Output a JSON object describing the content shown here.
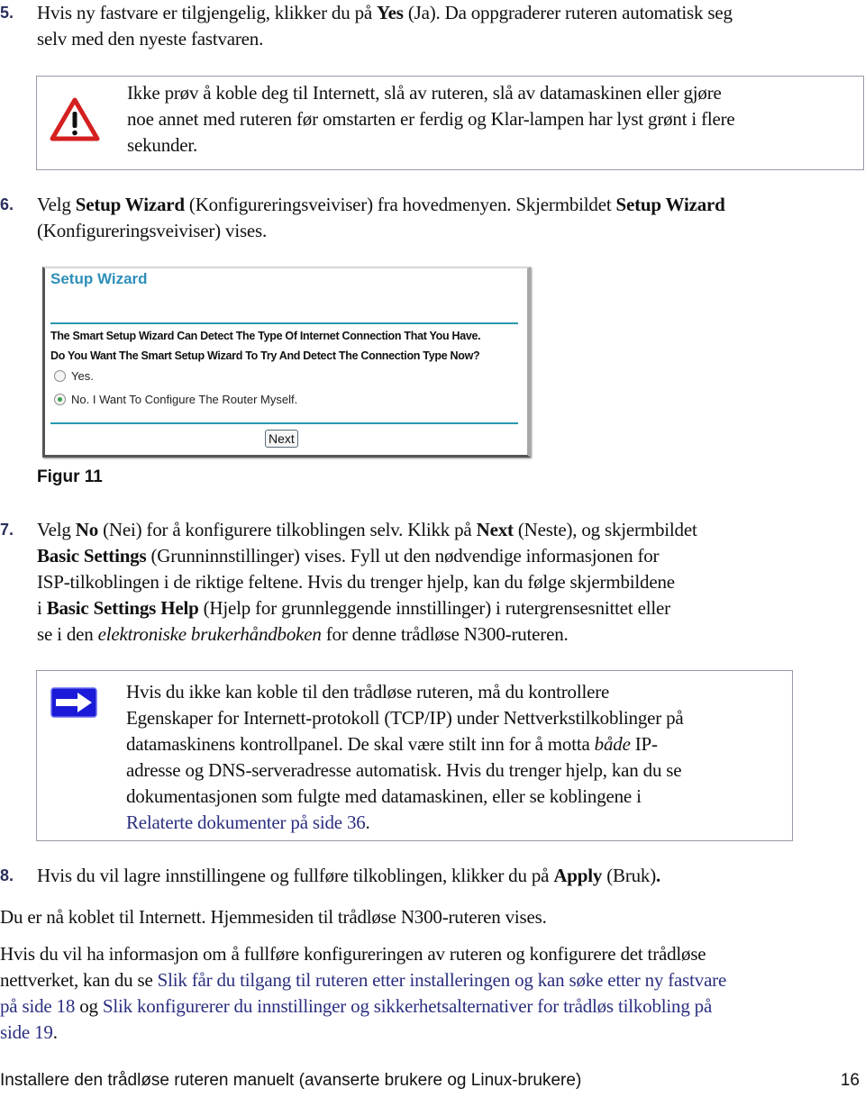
{
  "step5": {
    "number": "5.",
    "line1_pre": "Hvis ny fastvare er tilgjengelig, klikker du på ",
    "line1_bold": "Yes",
    "line1_post": " (Ja). Da oppgraderer ruteren automatisk seg",
    "line2": "selv med den nyeste fastvaren."
  },
  "warning": {
    "icon": "warning-triangle-icon",
    "lines": [
      "Ikke prøv å koble deg til Internett, slå av ruteren, slå av datamaskinen eller gjøre",
      "noe annet med ruteren før omstarten er ferdig og Klar-lampen har lyst grønt i flere",
      "sekunder."
    ]
  },
  "step6": {
    "number": "6.",
    "t1": "Velg ",
    "b1": "Setup Wizard",
    "t2": " (Konfigureringsveiviser) fra hovedmenyen. Skjermbildet ",
    "b2": "Setup Wizard",
    "t3": "(Konfigureringsveiviser) vises."
  },
  "wizard": {
    "title": "Setup Wizard",
    "question1": "The Smart Setup Wizard Can Detect The Type Of Internet Connection That You Have.",
    "question2": "Do You Want The Smart Setup Wizard To Try And Detect The Connection Type Now?",
    "options": [
      {
        "label": "Yes.",
        "selected": false
      },
      {
        "label": "No. I Want To Configure The Router Myself.",
        "selected": true
      }
    ],
    "next_button": "Next",
    "accent_color": "#2e8fb8"
  },
  "figure_caption": "Figur 11",
  "step7": {
    "number": "7.",
    "l1_a": "Velg ",
    "l1_b": "No",
    "l1_c": " (Nei) for å konfigurere tilkoblingen selv. Klikk på ",
    "l1_d": "Next",
    "l1_e": " (Neste), og skjermbildet",
    "l2_b": "Basic Settings",
    "l2_c": " (Grunninnstillinger) vises. Fyll ut den nødvendige informasjonen for",
    "l3": "ISP-tilkoblingen i de riktige feltene. Hvis du trenger hjelp, kan du følge skjermbildene",
    "l4_a": "i ",
    "l4_b": "Basic Settings Help",
    "l4_c": " (Hjelp for grunnleggende innstillinger) i rutergrensesnittet eller",
    "l5_a": "se i den ",
    "l5_i": "elektroniske brukerhåndboken",
    "l5_c": " for denne trådløse N300-ruteren."
  },
  "note": {
    "icon": "arrow-right-icon",
    "l1": "Hvis du ikke kan koble til den trådløse ruteren, må du kontrollere",
    "l2": "Egenskaper for Internett-protokoll (TCP/IP) under Nettverkstilkoblinger på",
    "l3_a": "datamaskinens kontrollpanel. De skal være stilt inn for å motta ",
    "l3_i": "både",
    "l3_c": " IP-",
    "l4": "adresse og DNS-serveradresse automatisk. Hvis du trenger hjelp, kan du se",
    "l5": "dokumentasjonen som fulgte med datamaskinen, eller se koblingene i",
    "link": "Relaterte dokumenter på side 36",
    "link_after": "."
  },
  "step8": {
    "number": "8.",
    "text": "Hvis du vil lagre innstillingene og fullføre tilkoblingen, klikker du på ",
    "bold": "Apply",
    "after": " (Bruk)",
    "period": "."
  },
  "para_connected": "Du er nå koblet til Internett. Hjemmesiden til trådløse N300-ruteren vises.",
  "para_more": {
    "l1": "Hvis du vil ha informasjon om å fullføre konfigureringen av ruteren og konfigurere det trådløse",
    "l2_a": "nettverket, kan du se ",
    "link1_part1": "Slik får du tilgang til ruteren etter installeringen og kan søke etter ny fastvare",
    "link1_part2": "på side 18",
    "og": " og ",
    "link2_part1": "Slik konfigurerer du innstillinger og sikkerhetsalternativer for trådløs tilkobling på",
    "link2_part2": "side 19",
    "end": "."
  },
  "footer": {
    "title": "Installere den trådløse ruteren manuelt (avanserte brukere og Linux-brukere)",
    "page_number": "16"
  },
  "colors": {
    "link": "#2b2f80",
    "step_number": "#2a2f5c",
    "warning_red": "#d42020",
    "note_blue": "#1a1ad8"
  }
}
